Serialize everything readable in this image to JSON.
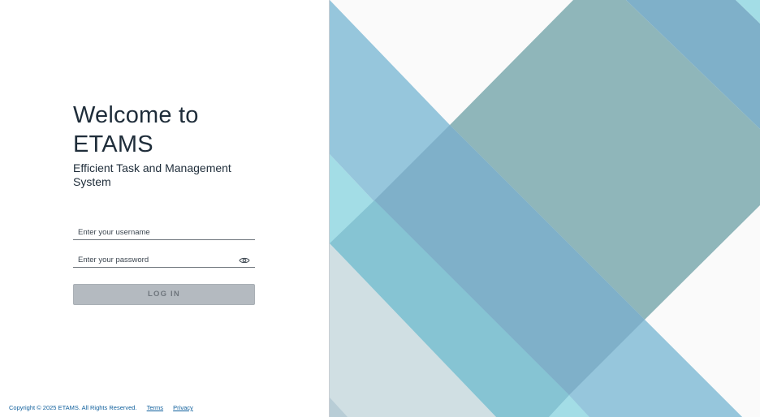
{
  "login": {
    "heading": "Welcome to ETAMS",
    "subtitle": "Efficient Task and Management System",
    "username_placeholder": "Enter your username",
    "password_placeholder": "Enter your password",
    "login_label": "LOG IN"
  },
  "footer": {
    "copyright": "Copyright © 2025 ETAMS. All Rights Reserved.",
    "terms_label": "Terms",
    "privacy_label": "Privacy"
  },
  "icons": {
    "password_toggle": "eye-icon"
  },
  "colors": {
    "heading": "#1f2d3a",
    "link": "#0f5f9c",
    "button_disabled": "#b4bac0",
    "pattern_blue": "#7fb0c9",
    "pattern_teal": "#8fb6ba",
    "pattern_cyan": "#a3dde6"
  }
}
